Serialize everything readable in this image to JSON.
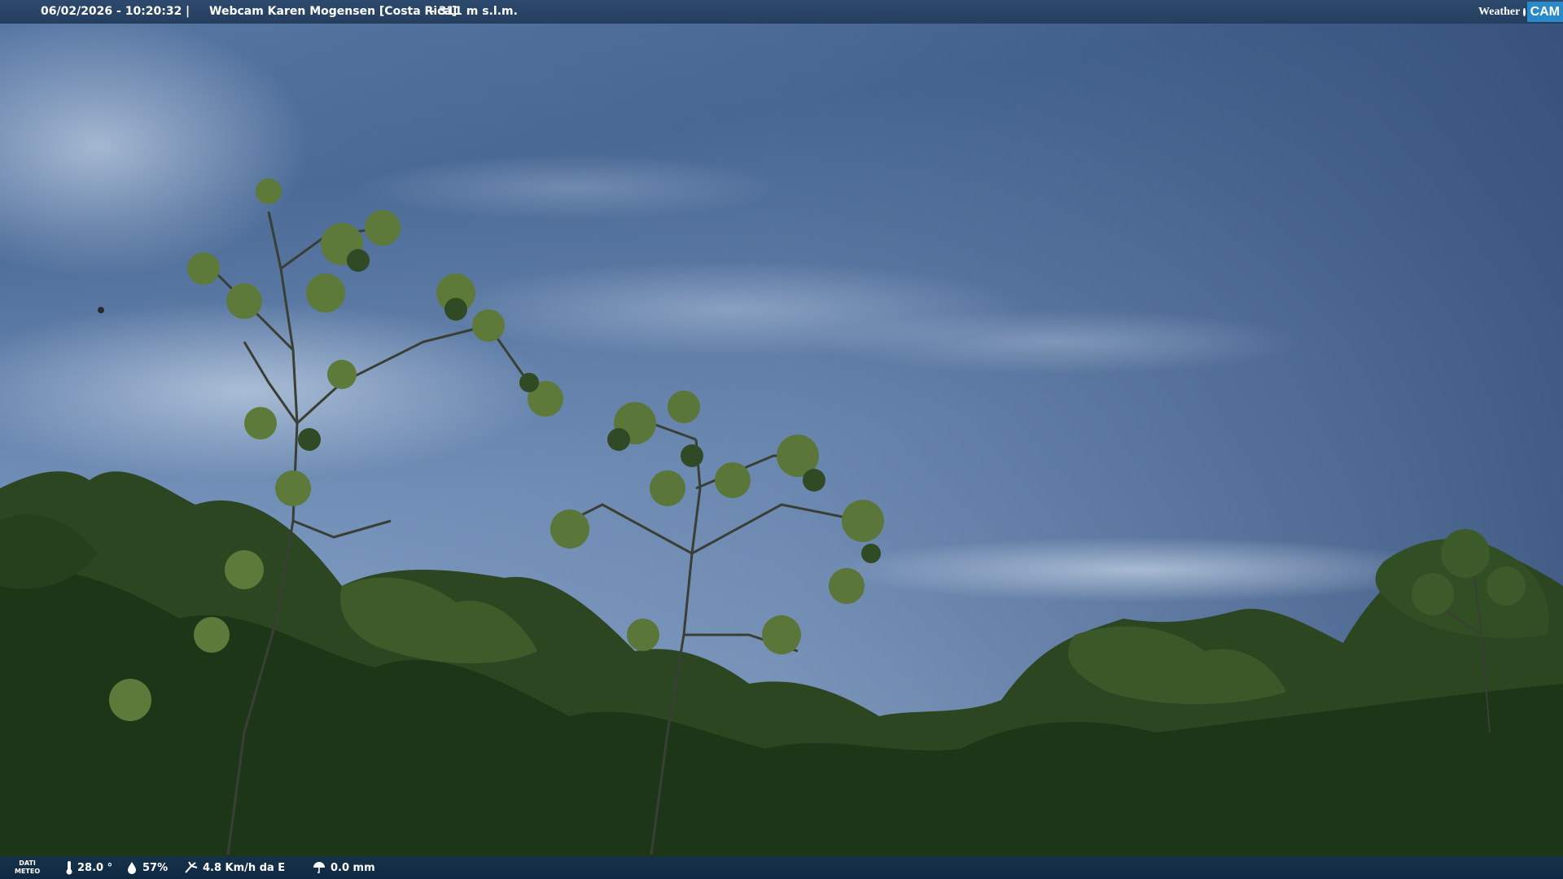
{
  "header": {
    "datetime": "06/02/2026 - 10:20:32",
    "separator": "|",
    "title": "Webcam Karen Mogensen [Costa Rica]",
    "altitude": "- 311 m s.l.m."
  },
  "logo": {
    "weather_text": "Weather",
    "cam_text": "CAM"
  },
  "weather_data": {
    "label_line1": "DATI",
    "label_line2": "METEO",
    "temperature": "28.0 °",
    "humidity": "57%",
    "wind": "4.8 Km/h da E",
    "rain": "0.0 mm"
  },
  "icons": {
    "temperature": "thermometer-icon",
    "humidity": "humidity-drop-icon",
    "wind": "wind-icon",
    "rain": "rain-umbrella-icon"
  },
  "colors": {
    "sky_top": "#3d5a85",
    "sky_mid": "#7b97bf",
    "foliage_dark": "#1e3618",
    "foliage_mid": "#3e5c2a",
    "bar_bg": "#243e5e",
    "logo_accent": "#2a89c8"
  }
}
